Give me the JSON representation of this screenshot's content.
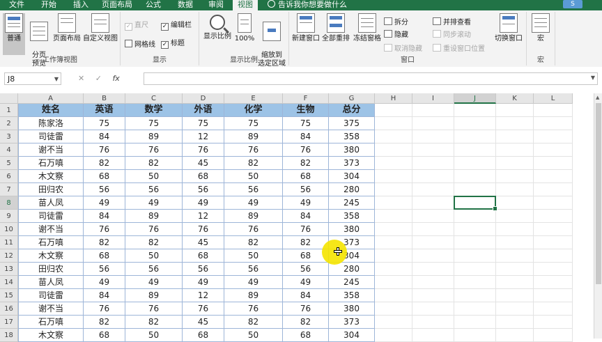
{
  "tabs": [
    "文件",
    "开始",
    "插入",
    "页面布局",
    "公式",
    "数据",
    "审阅",
    "视图"
  ],
  "active_tab": "视图",
  "tell_me": "告诉我你想要做什么",
  "account": "S",
  "ribbon": {
    "workbook_views": {
      "label": "工作簿视图",
      "buttons": [
        "普通",
        "分页\n预览",
        "页面布局",
        "自定义视图"
      ]
    },
    "show": {
      "label": "显示",
      "ruler": "直尺",
      "formula_bar": "编辑栏",
      "gridlines": "网格线",
      "headings": "标题"
    },
    "zoom": {
      "label": "显示比例",
      "zoom": "显示比例",
      "hundred": "100%",
      "zoom_selection": "缩放到\n选定区域"
    },
    "window": {
      "label": "窗口",
      "new_window": "新建窗口",
      "arrange_all": "全部重排",
      "freeze": "冻结窗格",
      "split": "拆分",
      "hide": "隐藏",
      "unhide": "取消隐藏",
      "side_by_side": "并排查看",
      "sync_scroll": "同步滚动",
      "reset_pos": "重设窗口位置",
      "switch": "切换窗口"
    },
    "macros": {
      "label": "宏",
      "macros": "宏"
    }
  },
  "formula_bar": {
    "name_box": "J8",
    "cancel": "✕",
    "enter": "✓",
    "fx": "fx",
    "content": ""
  },
  "columns": [
    "A",
    "B",
    "C",
    "D",
    "E",
    "F",
    "G",
    "H",
    "I",
    "J",
    "K",
    "L"
  ],
  "selected_col": "J",
  "selected_row": 8,
  "table": {
    "headers": [
      "姓名",
      "英语",
      "数学",
      "外语",
      "化学",
      "生物",
      "总分"
    ],
    "rows": [
      [
        "陈家洛",
        "75",
        "75",
        "75",
        "75",
        "75",
        "375"
      ],
      [
        "司徒雷",
        "84",
        "89",
        "12",
        "89",
        "84",
        "358"
      ],
      [
        "谢不当",
        "76",
        "76",
        "76",
        "76",
        "76",
        "380"
      ],
      [
        "石万嗔",
        "82",
        "82",
        "45",
        "82",
        "82",
        "373"
      ],
      [
        "木文察",
        "68",
        "50",
        "68",
        "50",
        "68",
        "304"
      ],
      [
        "田归农",
        "56",
        "56",
        "56",
        "56",
        "56",
        "280"
      ],
      [
        "苗人凤",
        "49",
        "49",
        "49",
        "49",
        "49",
        "245"
      ],
      [
        "司徒雷",
        "84",
        "89",
        "12",
        "89",
        "84",
        "358"
      ],
      [
        "谢不当",
        "76",
        "76",
        "76",
        "76",
        "76",
        "380"
      ],
      [
        "石万嗔",
        "82",
        "82",
        "45",
        "82",
        "82",
        "373"
      ],
      [
        "木文察",
        "68",
        "50",
        "68",
        "50",
        "68",
        "304"
      ],
      [
        "田归农",
        "56",
        "56",
        "56",
        "56",
        "56",
        "280"
      ],
      [
        "苗人凤",
        "49",
        "49",
        "49",
        "49",
        "49",
        "245"
      ],
      [
        "司徒雷",
        "84",
        "89",
        "12",
        "89",
        "84",
        "358"
      ],
      [
        "谢不当",
        "76",
        "76",
        "76",
        "76",
        "76",
        "380"
      ],
      [
        "石万嗔",
        "82",
        "82",
        "45",
        "82",
        "82",
        "373"
      ],
      [
        "木文察",
        "68",
        "50",
        "68",
        "50",
        "68",
        "304"
      ]
    ]
  },
  "colors": {
    "ribbon_green": "#217346",
    "header_fill": "#9dc3e6",
    "cursor_highlight": "#f5e400"
  }
}
